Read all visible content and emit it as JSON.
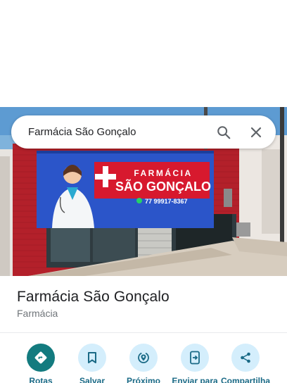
{
  "search": {
    "query": "Farmácia São Gonçalo"
  },
  "photo": {
    "banner_line1": "FARMÁCIA",
    "banner_line2": "SÃO GONÇALO",
    "banner_phone": "77 99917-8367"
  },
  "place": {
    "name": "Farmácia São Gonçalo",
    "category": "Farmácia"
  },
  "actions": [
    {
      "label": "Rotas"
    },
    {
      "label": "Salvar"
    },
    {
      "label": "Próximo"
    },
    {
      "label": "Enviar para"
    },
    {
      "label": "Compartilha"
    }
  ],
  "colors": {
    "primary_action": "#137b7f",
    "action_bg": "#d4eefc",
    "action_label": "#1a6a86",
    "banner_blue": "#2b55c9",
    "banner_red": "#d7192e"
  }
}
